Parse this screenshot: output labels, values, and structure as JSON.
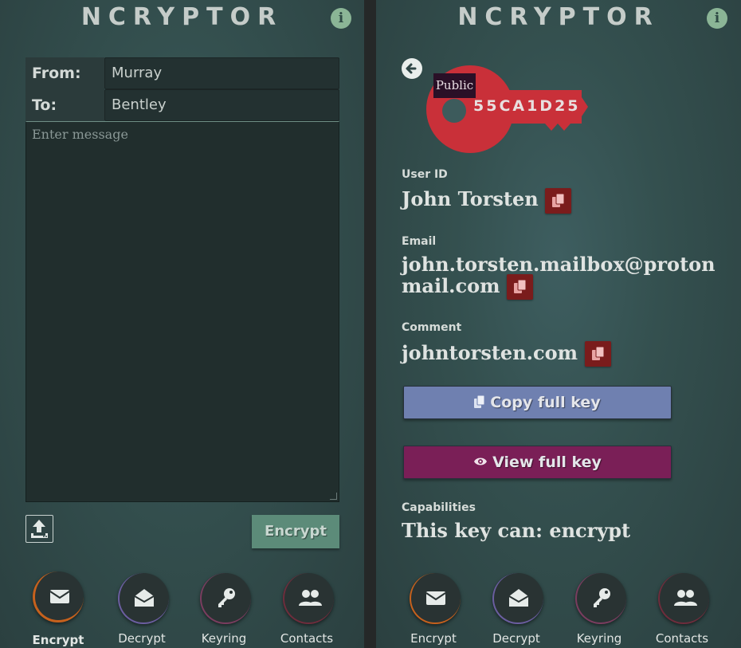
{
  "app": {
    "title": "NCRYPTOR",
    "info_icon": "info-icon"
  },
  "encrypt_form": {
    "from_label": "From:",
    "from_value": "Murray",
    "to_label": "To:",
    "to_value": "Bentley",
    "message_placeholder": "Enter message",
    "encrypt_label": "Encrypt"
  },
  "nav": {
    "items": [
      {
        "label": "Encrypt",
        "icon": "envelope-icon"
      },
      {
        "label": "Decrypt",
        "icon": "open-envelope-icon"
      },
      {
        "label": "Keyring",
        "icon": "key-icon"
      },
      {
        "label": "Contacts",
        "icon": "users-icon"
      }
    ],
    "left_active": "Encrypt"
  },
  "key_details": {
    "key_type": "Public",
    "key_id": "55CA1D25",
    "user_id_label": "User ID",
    "user_id": "John Torsten",
    "email_label": "Email",
    "email_line1": "john.torsten.mailbox@proton",
    "email_line2": "mail.com",
    "comment_label": "Comment",
    "comment": "johntorsten.com",
    "copy_full_key_label": "Copy full key",
    "view_full_key_label": "View full key",
    "capabilities_label": "Capabilities",
    "capabilities": "This key can: encrypt"
  },
  "colors": {
    "accent_green": "#5c8b79",
    "key_red": "#c93039",
    "copy_button": "#6f80b0",
    "view_button": "#7a1f57",
    "active_ring": "#c6611d"
  }
}
